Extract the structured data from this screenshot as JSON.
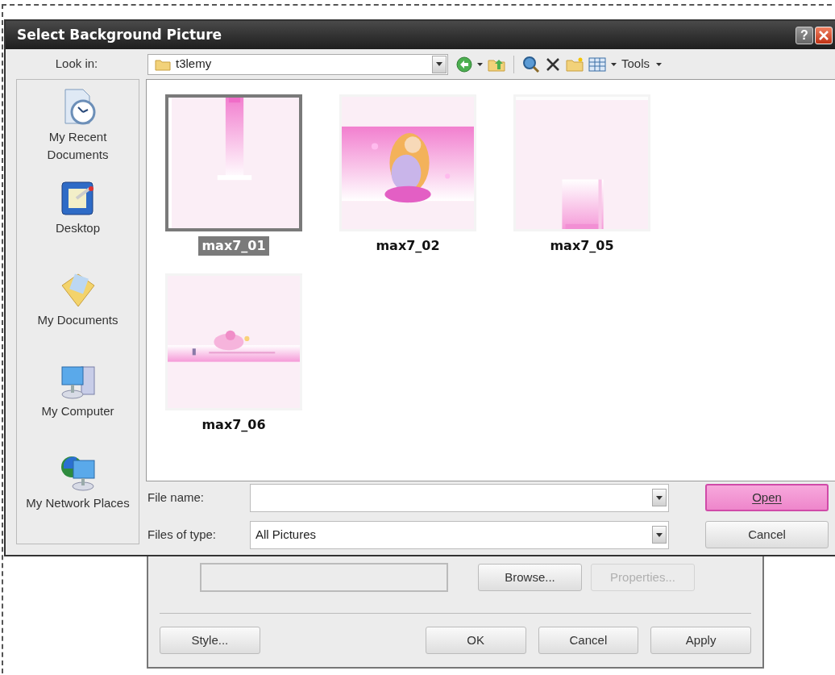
{
  "window": {
    "title": "Select Background Picture",
    "help": "?"
  },
  "look_in": {
    "label": "Look in:",
    "value": "t3lemy"
  },
  "toolbar": {
    "tools_label": "Tools"
  },
  "places": [
    {
      "label": "My Recent Documents",
      "kind": "recent"
    },
    {
      "label": "Desktop",
      "kind": "desktop"
    },
    {
      "label": "My Documents",
      "kind": "documents"
    },
    {
      "label": "My Computer",
      "kind": "computer"
    },
    {
      "label": "My Network Places",
      "kind": "network"
    }
  ],
  "files": [
    {
      "name": "max7_01",
      "selected": true
    },
    {
      "name": "max7_02",
      "selected": false
    },
    {
      "name": "max7_05",
      "selected": false
    },
    {
      "name": "max7_06",
      "selected": false
    }
  ],
  "file_name": {
    "label": "File name:"
  },
  "file_type": {
    "label": "Files of type:",
    "value": "All Pictures"
  },
  "dialog_buttons": [
    {
      "label": "Open",
      "focused": true
    },
    {
      "label": "Cancel",
      "focused": false
    }
  ],
  "background_dialog": {
    "top_buttons": [
      {
        "label": "Browse...",
        "disabled": false
      },
      {
        "label": "Properties...",
        "disabled": true
      }
    ],
    "bottom_buttons": [
      {
        "label": "Style...",
        "disabled": false
      },
      {
        "label": "OK",
        "disabled": false
      },
      {
        "label": "Cancel",
        "disabled": false
      },
      {
        "label": "Apply",
        "disabled": false
      }
    ]
  }
}
